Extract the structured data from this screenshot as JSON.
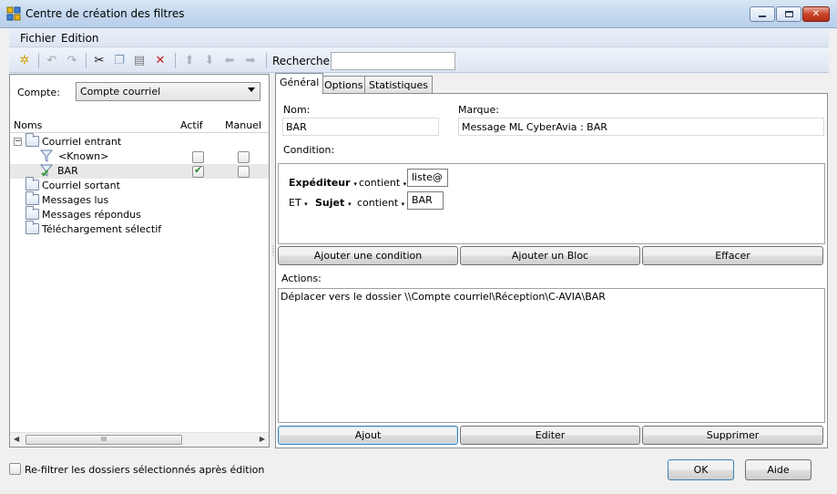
{
  "window": {
    "title": "Centre de création des filtres"
  },
  "menu": {
    "file": "Fichier",
    "edit": "Edition"
  },
  "toolbar": {
    "search_label": "Rechercher",
    "search_value": ""
  },
  "left": {
    "account_label": "Compte:",
    "account_value": "Compte courriel",
    "columns": {
      "name": "Noms",
      "active": "Actif",
      "manual": "Manuel"
    },
    "tree": {
      "incoming": "Courriel entrant",
      "known": "<Known>",
      "bar": "BAR",
      "outgoing": "Courriel sortant",
      "read": "Messages lus",
      "replied": "Messages répondus",
      "selective": "Téléchargement sélectif"
    }
  },
  "tabs": {
    "general": "Général",
    "options": "Options",
    "stats": "Statistiques"
  },
  "form": {
    "name_label": "Nom:",
    "name_value": "BAR",
    "mark_label": "Marque:",
    "mark_value": "Message ML CyberAvia : BAR",
    "condition_label": "Condition:",
    "cond1": {
      "field": "Expéditeur",
      "op": "contient",
      "value": "liste@"
    },
    "cond2": {
      "join": "ET",
      "field": "Sujet",
      "op": "contient",
      "value": "BAR"
    },
    "add_condition": "Ajouter une condition",
    "add_block": "Ajouter un Bloc",
    "clear": "Effacer",
    "actions_label": "Actions:",
    "action_text": "Déplacer vers le dossier \\\\Compte courriel\\Réception\\C-AVIA\\BAR",
    "add": "Ajout",
    "edit": "Editer",
    "delete": "Supprimer"
  },
  "footer": {
    "refilter": "Re-filtrer les dossiers sélectionnés après édition",
    "ok": "OK",
    "help": "Aide"
  }
}
